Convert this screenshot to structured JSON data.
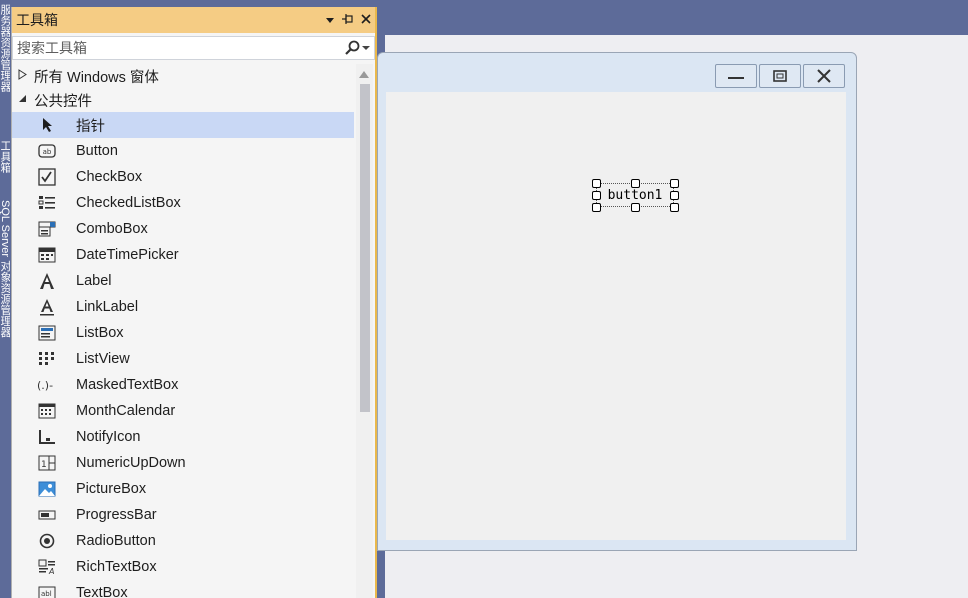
{
  "side_tabs": [
    "服务器资源管理器",
    "工具箱",
    "SQL Server 对象资源管理器"
  ],
  "toolbox": {
    "title": "工具箱",
    "search_placeholder": "搜索工具箱",
    "groups": [
      {
        "label": "所有 Windows 窗体",
        "expanded": false
      },
      {
        "label": "公共控件",
        "expanded": true
      }
    ],
    "items": [
      {
        "label": "指针",
        "icon": "pointer-icon",
        "selected": true
      },
      {
        "label": "Button",
        "icon": "button-icon"
      },
      {
        "label": "CheckBox",
        "icon": "checkbox-icon"
      },
      {
        "label": "CheckedListBox",
        "icon": "checkedlistbox-icon"
      },
      {
        "label": "ComboBox",
        "icon": "combobox-icon"
      },
      {
        "label": "DateTimePicker",
        "icon": "datetimepicker-icon"
      },
      {
        "label": "Label",
        "icon": "label-icon"
      },
      {
        "label": "LinkLabel",
        "icon": "linklabel-icon"
      },
      {
        "label": "ListBox",
        "icon": "listbox-icon"
      },
      {
        "label": "ListView",
        "icon": "listview-icon"
      },
      {
        "label": "MaskedTextBox",
        "icon": "maskedtextbox-icon"
      },
      {
        "label": "MonthCalendar",
        "icon": "monthcalendar-icon"
      },
      {
        "label": "NotifyIcon",
        "icon": "notifyicon-icon"
      },
      {
        "label": "NumericUpDown",
        "icon": "numericupdown-icon"
      },
      {
        "label": "PictureBox",
        "icon": "picturebox-icon"
      },
      {
        "label": "ProgressBar",
        "icon": "progressbar-icon"
      },
      {
        "label": "RadioButton",
        "icon": "radiobutton-icon"
      },
      {
        "label": "RichTextBox",
        "icon": "richtextbox-icon"
      },
      {
        "label": "TextBox",
        "icon": "textbox-icon"
      }
    ]
  },
  "form": {
    "button1_text": "button1"
  },
  "colors": {
    "toolbox_title_bg": "#f5cc84",
    "selected_item_bg": "#c9d8f5",
    "chrome_bg": "#5d6b99",
    "form_frame": "#dbe6f3"
  }
}
